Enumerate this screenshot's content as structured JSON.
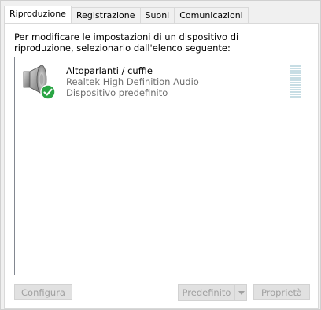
{
  "tabs": [
    {
      "label": "Riproduzione",
      "active": true
    },
    {
      "label": "Registrazione",
      "active": false
    },
    {
      "label": "Suoni",
      "active": false
    },
    {
      "label": "Comunicazioni",
      "active": false
    }
  ],
  "instruction": "Per modificare le impostazioni di un dispositivo di riproduzione, selezionarlo dall'elenco seguente:",
  "devices": [
    {
      "name": "Altoparlanti / cuffie",
      "driver": "Realtek High Definition Audio",
      "status": "Dispositivo predefinito",
      "icon": "speaker-icon",
      "badge": "default-checkmark-icon"
    }
  ],
  "buttons": {
    "configure": "Configura",
    "set_default": "Predefinito",
    "properties": "Proprietà"
  },
  "colors": {
    "badge_green": "#2aa544",
    "meter": "#c7dde4",
    "disabled_text": "#a0a0a0"
  }
}
